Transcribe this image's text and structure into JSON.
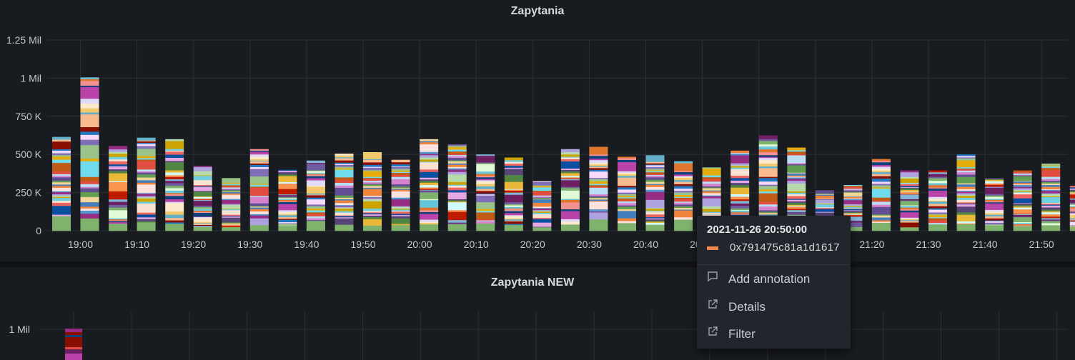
{
  "panel1": {
    "title": "Zapytania",
    "y_ticks": [
      "1.25 Mil",
      "1 Mil",
      "750 K",
      "500 K",
      "250 K",
      "0"
    ],
    "x_ticks": [
      "19:00",
      "19:10",
      "19:20",
      "19:30",
      "19:40",
      "19:50",
      "20:00",
      "20:10",
      "20:20",
      "20:30",
      "20:40",
      "20:50",
      "21:00",
      "21:10",
      "21:20",
      "21:30",
      "21:40",
      "21:50"
    ]
  },
  "panel2": {
    "title": "Zapytania NEW",
    "y_ticks": [
      "1 Mil"
    ]
  },
  "tooltip": {
    "time": "2021-11-26 20:50:00",
    "series_name": "0x791475c81a1d1617",
    "series_color": "#f2874a",
    "actions": [
      {
        "label": "Add annotation",
        "icon": "comment-icon"
      },
      {
        "label": "Details",
        "icon": "external-link-icon"
      },
      {
        "label": "Filter",
        "icon": "external-link-icon"
      }
    ]
  },
  "chart_data": {
    "type": "bar",
    "stacked": true,
    "title": "Zapytania",
    "ylim": [
      0,
      1250000
    ],
    "y_ticks": [
      "0",
      "250 K",
      "500 K",
      "750 K",
      "1 Mil",
      "1.25 Mil"
    ],
    "x_ticks": [
      "19:00",
      "19:10",
      "19:20",
      "19:30",
      "19:40",
      "19:50",
      "20:00",
      "20:10",
      "20:20",
      "20:30",
      "20:40",
      "20:50",
      "21:00",
      "21:10",
      "21:20",
      "21:30",
      "21:40",
      "21:50"
    ],
    "categories": [
      "18:55",
      "19:00",
      "19:05",
      "19:10",
      "19:15",
      "19:20",
      "19:25",
      "19:30",
      "19:35",
      "19:40",
      "19:45",
      "19:50",
      "19:55",
      "20:00",
      "20:05",
      "20:10",
      "20:15",
      "20:20",
      "20:25",
      "20:30",
      "20:35",
      "20:40",
      "20:45",
      "20:50",
      "20:55",
      "21:00",
      "21:05",
      "21:10",
      "21:15",
      "21:20",
      "21:25",
      "21:30",
      "21:35",
      "21:40",
      "21:45",
      "21:50"
    ],
    "totals": [
      615000,
      1005000,
      555000,
      610000,
      600000,
      425000,
      345000,
      535000,
      400000,
      460000,
      505000,
      515000,
      465000,
      600000,
      565000,
      500000,
      480000,
      325000,
      535000,
      550000,
      485000,
      495000,
      455000,
      415000,
      525000,
      625000,
      545000,
      265000,
      300000,
      470000,
      395000,
      395000,
      500000,
      345000,
      395000,
      440000,
      295000
    ],
    "grid": true,
    "legend": "none",
    "series_palette": [
      "#7eb26d",
      "#eab839",
      "#6ed0e0",
      "#ef843c",
      "#e24d42",
      "#1f78c1",
      "#ba43a9",
      "#705da0",
      "#508642",
      "#cca300",
      "#447ebc",
      "#c15c17",
      "#890f02",
      "#0a437c",
      "#6d1f62",
      "#584477",
      "#b7dbab",
      "#f4d598",
      "#70dbed",
      "#f9ba8f",
      "#f29191",
      "#82b5d8",
      "#e5a8e2",
      "#aea2e0",
      "#629e51",
      "#e5ac0e",
      "#64b0c8",
      "#e0752d",
      "#bf1b00",
      "#0a50a1",
      "#962d82",
      "#614d93",
      "#9ac48a",
      "#f2c96d",
      "#65c5db",
      "#f9934e",
      "#ea6460",
      "#5195ce",
      "#d683ce",
      "#806eb7",
      "#fceaca",
      "#e0f9d7",
      "#cffaff",
      "#f9e2d2",
      "#fce2de",
      "#badff4",
      "#f9d9f9",
      "#dedaf7"
    ]
  }
}
